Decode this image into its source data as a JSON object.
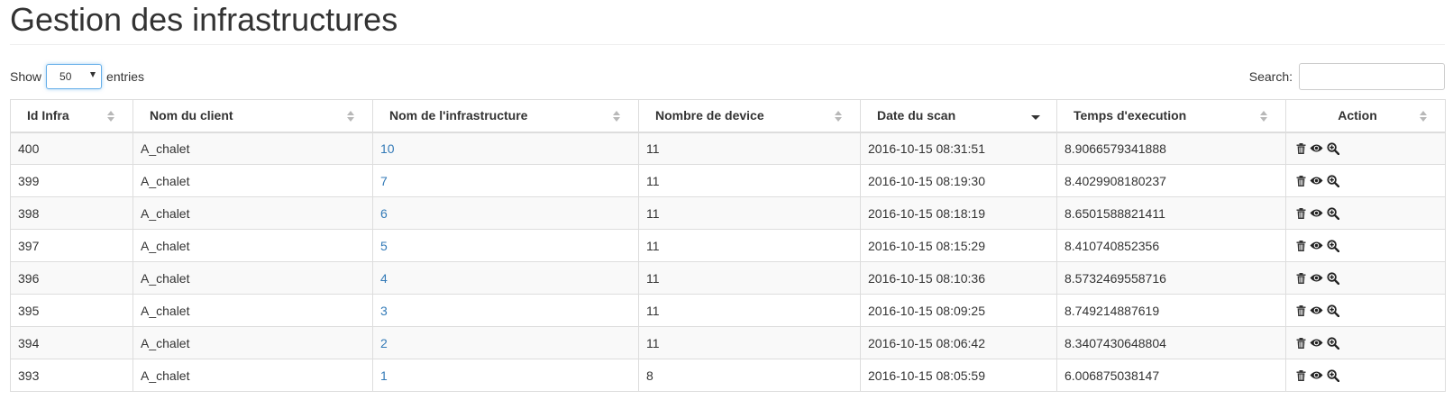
{
  "page": {
    "title": "Gestion des infrastructures"
  },
  "length": {
    "prefix": "Show",
    "value": "50",
    "suffix": "entries"
  },
  "search": {
    "label": "Search:",
    "value": ""
  },
  "table": {
    "columns": [
      {
        "label": "Id Infra",
        "sort": "both"
      },
      {
        "label": "Nom du client",
        "sort": "both"
      },
      {
        "label": "Nom de l'infrastructure",
        "sort": "both"
      },
      {
        "label": "Nombre de device",
        "sort": "both"
      },
      {
        "label": "Date du scan",
        "sort": "desc"
      },
      {
        "label": "Temps d'execution",
        "sort": "both"
      },
      {
        "label": "Action",
        "sort": "both"
      }
    ],
    "rows": [
      {
        "id": "400",
        "client": "A_chalet",
        "infra": "10",
        "devices": "11",
        "date": "2016-10-15 08:31:51",
        "time": "8.9066579341888"
      },
      {
        "id": "399",
        "client": "A_chalet",
        "infra": "7",
        "devices": "11",
        "date": "2016-10-15 08:19:30",
        "time": "8.4029908180237"
      },
      {
        "id": "398",
        "client": "A_chalet",
        "infra": "6",
        "devices": "11",
        "date": "2016-10-15 08:18:19",
        "time": "8.6501588821411"
      },
      {
        "id": "397",
        "client": "A_chalet",
        "infra": "5",
        "devices": "11",
        "date": "2016-10-15 08:15:29",
        "time": "8.410740852356"
      },
      {
        "id": "396",
        "client": "A_chalet",
        "infra": "4",
        "devices": "11",
        "date": "2016-10-15 08:10:36",
        "time": "8.5732469558716"
      },
      {
        "id": "395",
        "client": "A_chalet",
        "infra": "3",
        "devices": "11",
        "date": "2016-10-15 08:09:25",
        "time": "8.749214887619"
      },
      {
        "id": "394",
        "client": "A_chalet",
        "infra": "2",
        "devices": "11",
        "date": "2016-10-15 08:06:42",
        "time": "8.3407430648804"
      },
      {
        "id": "393",
        "client": "A_chalet",
        "infra": "1",
        "devices": "8",
        "date": "2016-10-15 08:05:59",
        "time": "6.006875038147"
      }
    ],
    "actions": [
      "trash-icon",
      "eye-icon",
      "zoom-in-icon"
    ]
  },
  "colors": {
    "link": "#337ab7",
    "border": "#dddddd",
    "stripe": "#f9f9f9",
    "text": "#333333"
  }
}
